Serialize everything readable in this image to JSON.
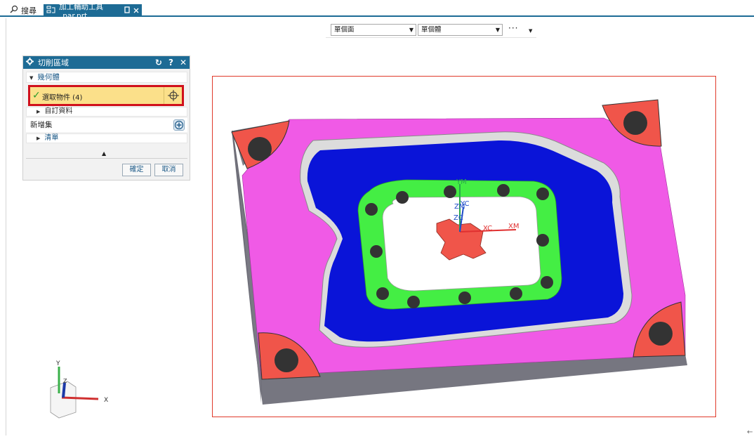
{
  "tabs": {
    "search_label": "搜尋",
    "file_label": "加工輔助工具_par.prt"
  },
  "selection_bar": {
    "filter_value": "單個面",
    "scope_value": "單個體",
    "more_label": "···"
  },
  "dialog": {
    "title": "切削區域",
    "section_geometry": "幾何體",
    "select_object_label": "選取物件 (4)",
    "custom_data_label": "自訂資料",
    "new_set_label": "新增集",
    "list_label": "清單",
    "ok_label": "確定",
    "cancel_label": "取消"
  },
  "model_labels": {
    "ym": "YM",
    "zm": "ZM",
    "yc": "YC",
    "zc": "ZC",
    "xc": "XC",
    "xm": "XM"
  },
  "triad_labels": {
    "x": "X",
    "y": "Y",
    "z": "Z"
  },
  "colors": {
    "accent": "#1d6b95",
    "selection_highlight": "#fbe08a",
    "selection_border": "#d0101b",
    "block_top": "#f05ae6",
    "pocket_floor": "#0a14d8",
    "rib_top": "#44ee44",
    "corner_face": "#f0554a",
    "frame": "#e03a2a"
  },
  "icons": [
    "search-icon",
    "file-icon",
    "pin-icon",
    "close-icon",
    "gear-icon",
    "reset-icon",
    "help-icon",
    "crosshair-icon",
    "add-icon"
  ]
}
